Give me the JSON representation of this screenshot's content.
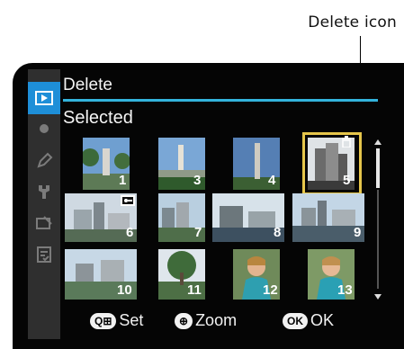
{
  "annotation": {
    "label": "Delete icon"
  },
  "sidebar": {
    "tabs": [
      {
        "icon": "playback-icon",
        "active": true
      },
      {
        "icon": "camera-icon",
        "active": false
      },
      {
        "icon": "pencil-icon",
        "active": false
      },
      {
        "icon": "wrench-icon",
        "active": false
      },
      {
        "icon": "retouch-icon",
        "active": false
      },
      {
        "icon": "recent-settings-icon",
        "active": false
      }
    ]
  },
  "menu": {
    "title": "Delete",
    "subtitle": "Selected"
  },
  "thumbnails": [
    {
      "number": "1"
    },
    {
      "number": "3"
    },
    {
      "number": "4"
    },
    {
      "number": "5",
      "selected": true,
      "marked_for_delete": true
    },
    {
      "number": "6",
      "protected": true
    },
    {
      "number": "7"
    },
    {
      "number": "8"
    },
    {
      "number": "9"
    },
    {
      "number": "10"
    },
    {
      "number": "11"
    },
    {
      "number": "12"
    },
    {
      "number": "13"
    }
  ],
  "footer": {
    "set": {
      "glyph": "Q⊞",
      "label": "Set"
    },
    "zoom": {
      "glyph": "⊕",
      "label": "Zoom"
    },
    "ok": {
      "glyph": "OK",
      "label": "OK"
    }
  },
  "colors": {
    "accent": "#1e8fd8",
    "rule": "#33b3dc",
    "selection": "#e6c64b"
  }
}
